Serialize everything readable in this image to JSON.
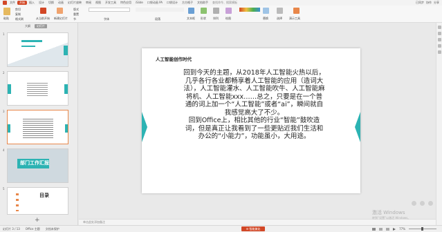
{
  "menubar": {
    "tabs": [
      "文件",
      "开始",
      "插入",
      "设计",
      "切换",
      "动画",
      "幻灯片放映",
      "审阅",
      "视图",
      "开发工具",
      "特色应用",
      "iSlide",
      "口袋动画 PA",
      "口袋设计",
      "方方格子",
      "文档助手"
    ],
    "active_tab": "开始",
    "search_placeholder": "查找命令、搜索模板",
    "right_items": [
      "已同步",
      "协作",
      "分享"
    ]
  },
  "ribbon": {
    "labels": [
      "粘贴",
      "剪切",
      "复制",
      "格式刷",
      "从当前开始",
      "新建幻灯片",
      "版式",
      "重置",
      "节",
      "字体",
      "段落",
      "文本框",
      "形状",
      "排列",
      "绘图",
      "替换",
      "选择",
      "演示工具"
    ]
  },
  "thumbs": {
    "tabs": [
      "大纲",
      "幻灯片"
    ],
    "active_tab": "幻灯片",
    "numbers": [
      "1",
      "2",
      "3",
      "4",
      "5"
    ],
    "thumb4_title": "部门工作汇报",
    "thumb5_title": "目录",
    "add_label": "+"
  },
  "slide": {
    "title": "人工智能创作时代",
    "para1": "回到今天的主题，从2018年人工智能火热以后，几乎各行各业都畅享着人工智能的应用（造词大法），人工智能灌水、人工智能吹牛、人工智能麻将机、人工智能xxx……总之，只要是在一个普通的词上加一个“人工智能”或者“ai”，瞬间就自我感觉高大了不少。",
    "para2": "回到Office上，相比其他的行业“智能”鼓吹造词，但是真正让我看到了一些更贴近我们生活和办公的“小能力”，功能虽小，大用途。"
  },
  "notes": {
    "placeholder": "单击此处添加备注"
  },
  "watermark": {
    "line1": "激活 Windows",
    "line2": "转到“设置”以激活 Windows。"
  },
  "status": {
    "slide_info": "幻灯片 3 / 13",
    "theme": "Office 主题",
    "spell": "文档未保护",
    "mid_button": "☰ 智能美化",
    "zoom": "77%"
  },
  "colors": {
    "accent": "#d24726",
    "teal": "#2cb3b3"
  }
}
